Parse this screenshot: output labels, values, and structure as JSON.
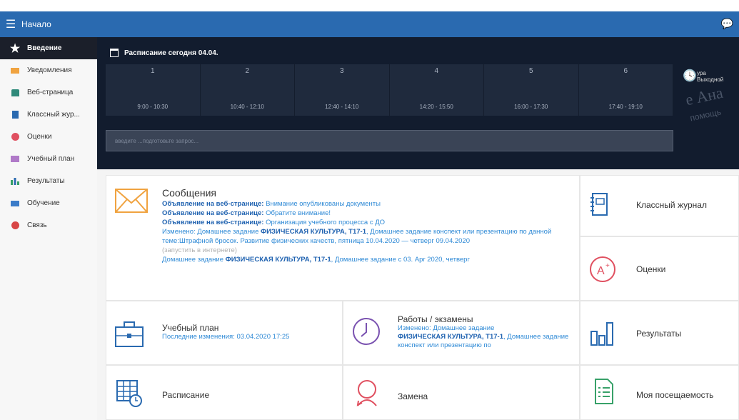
{
  "appbar": {
    "title": "Начало"
  },
  "sidebar": {
    "items": [
      {
        "label": "Введение",
        "icon": "star-icon"
      },
      {
        "label": "Уведомления",
        "icon": "notifications-icon"
      },
      {
        "label": "Веб-страница",
        "icon": "home-icon"
      },
      {
        "label": "Классный жур...",
        "icon": "journal-icon"
      },
      {
        "label": "Оценки",
        "icon": "grades-icon"
      },
      {
        "label": "Учебный план",
        "icon": "plan-icon"
      },
      {
        "label": "Результаты",
        "icon": "chart-icon"
      },
      {
        "label": "Обучение",
        "icon": "learning-icon"
      },
      {
        "label": "Связь",
        "icon": "communication-icon"
      }
    ]
  },
  "hero": {
    "heading": "Расписание сегодня 04.04.",
    "slots": [
      {
        "num": "1",
        "time": "9:00 - 10:30"
      },
      {
        "num": "2",
        "time": "10:40 - 12:10"
      },
      {
        "num": "3",
        "time": "12:40 - 14:10"
      },
      {
        "num": "4",
        "time": "14:20 - 15:50"
      },
      {
        "num": "5",
        "time": "16:00 - 17:30"
      },
      {
        "num": "6",
        "time": "17:40 - 19:10"
      }
    ],
    "side_label1": "ура",
    "side_label2": "Выходной",
    "watermark1": "е Ана",
    "watermark2": "помощь",
    "input_placeholder": "введите ...подготовьте запрос..."
  },
  "messages": {
    "title": "Сообщения",
    "lines": [
      {
        "prefix": "Объявление на веб-странице:",
        "text": " Внимание опубликованы документы"
      },
      {
        "prefix": "Объявление на веб-странице:",
        "text": " Обратите внимание!"
      },
      {
        "prefix": "Объявление на веб-странице:",
        "text": " Организация учебного процесса с ДО"
      }
    ],
    "hw1_a": "Изменено: Домашнее задание ",
    "hw1_b": "ФИЗИЧЕСКАЯ КУЛЬТУРА, Т17-1",
    "hw1_c": ", Домашнее задание конспект или презентацию по данной теме:Штрафной бросок. Развитие физических качеств, пятница 10.04.2020 — четверг 09.04.2020",
    "run_link": "(запустить в интернете)",
    "hw2_a": "Домашнее задание ",
    "hw2_b": "ФИЗИЧЕСКАЯ КУЛЬТУРА, Т17-1",
    "hw2_c": ", Домашнее задание с 03. Apr 2020, четверг"
  },
  "tiles": {
    "journal": "Классный журнал",
    "grades": "Оценки",
    "plan": "Учебный план",
    "plan_sub": "Последние изменения: 03.04.2020 17:25",
    "works": "Работы / экзамены",
    "works_sub_a": "Изменено: Домашнее задание",
    "works_sub_b": "ФИЗИЧЕСКАЯ КУЛЬТУРА, Т17-1",
    "works_sub_c": ", Домашнее задание конспект или презентацию по",
    "results": "Результаты",
    "schedule": "Расписание",
    "replace": "Замена",
    "attendance": "Моя посещаемость"
  },
  "colors": {
    "accent": "#2a6ab0",
    "link": "#2f8ad6",
    "orange": "#f0a340",
    "red": "#e05060",
    "green": "#38a169"
  }
}
